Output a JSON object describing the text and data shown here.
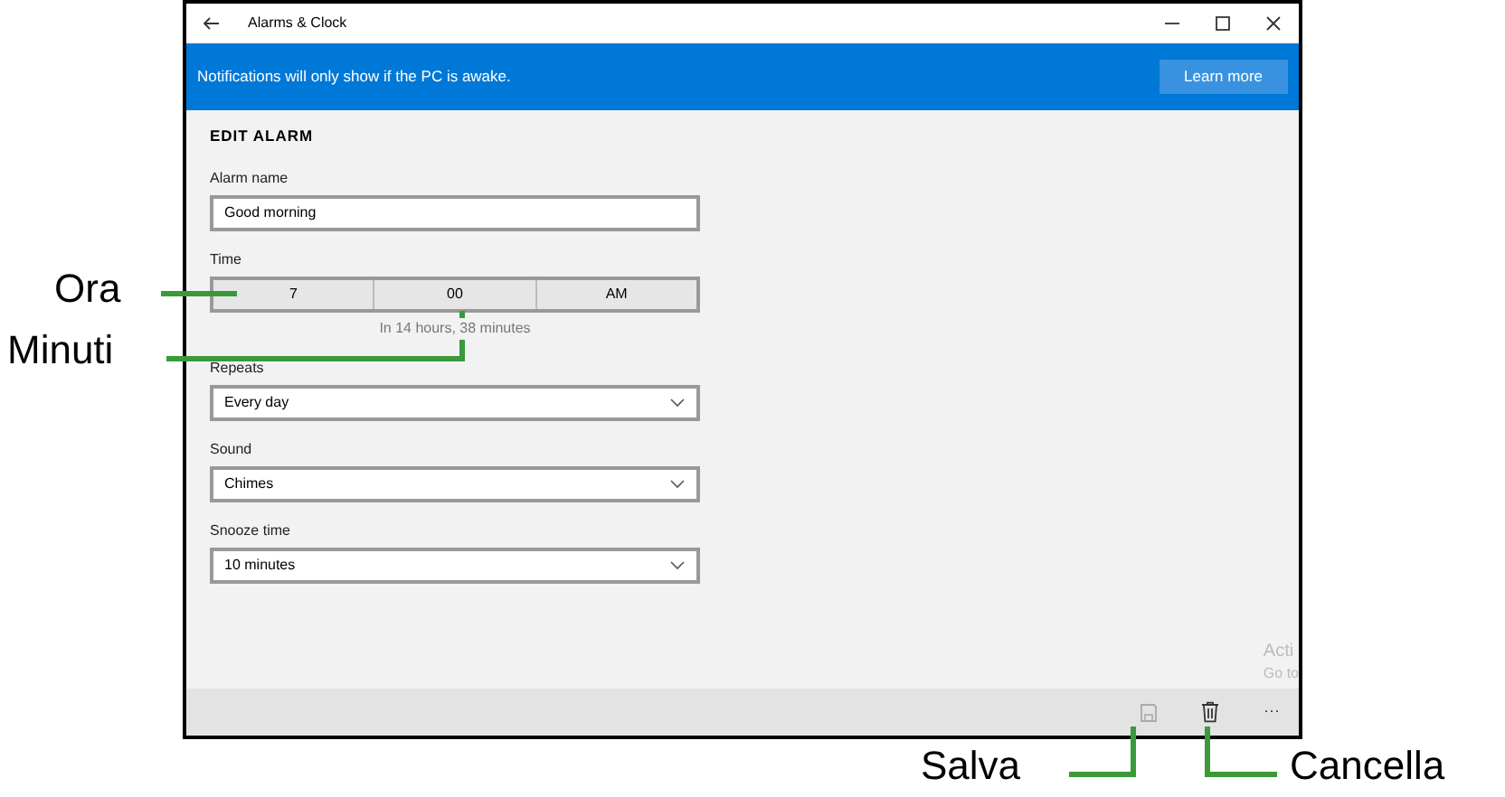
{
  "window": {
    "title": "Alarms & Clock"
  },
  "notification": {
    "text": "Notifications will only show if the PC is awake.",
    "button": "Learn more"
  },
  "heading": "EDIT ALARM",
  "fields": [
    {
      "kind": "text",
      "label": "Alarm name",
      "value": "Good morning"
    },
    {
      "kind": "time",
      "label": "Time",
      "segments": [
        "7",
        "00",
        "AM"
      ],
      "hint": "In 14 hours, 38 minutes"
    },
    {
      "kind": "dropdown",
      "label": "Repeats",
      "value": "Every day"
    },
    {
      "kind": "dropdown",
      "label": "Sound",
      "value": "Chimes"
    },
    {
      "kind": "dropdown",
      "label": "Snooze time",
      "value": "10 minutes"
    }
  ],
  "activation_notice": [
    "Acti",
    "Go to"
  ],
  "command_bar": [
    {
      "kind": "save",
      "disabled": true
    },
    {
      "kind": "delete",
      "disabled": false
    },
    {
      "kind": "more",
      "label": "···",
      "disabled": false
    }
  ],
  "annotations": [
    "Ora",
    "Minuti",
    "Salva",
    "Cancella"
  ]
}
